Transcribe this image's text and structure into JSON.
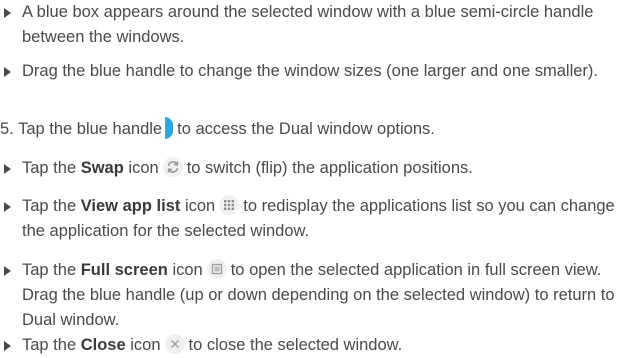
{
  "items": [
    {
      "type": "bullet",
      "text": "A blue box appears around the selected window with a blue semi-circle handle between the windows."
    },
    {
      "type": "bullet",
      "text": "Drag the blue handle to change the window sizes (one larger and one smaller)."
    },
    {
      "type": "step",
      "number": "5.",
      "before": "Tap the blue handle",
      "after": "to access the Dual window options.",
      "icon": "blue-handle-icon"
    },
    {
      "type": "bullet",
      "before": "Tap the",
      "bold": "Swap",
      "middle": "icon",
      "after": "to switch (flip) the application positions.",
      "icon": "swap-icon"
    },
    {
      "type": "bullet",
      "before": "Tap the",
      "bold": "View app list",
      "middle": "icon",
      "after": "to redisplay the applications list so you can change the application for the selected window.",
      "icon": "app-list-icon"
    },
    {
      "type": "bullet",
      "before": "Tap the",
      "bold": "Full screen",
      "middle": "icon",
      "after": "to open the selected application in full screen view. Drag the blue handle (up or down depending on the selected window) to return to Dual window.",
      "icon": "full-screen-icon"
    },
    {
      "type": "bullet",
      "before": "Tap the",
      "bold": "Close",
      "middle": "icon",
      "after": "to close the selected window.",
      "icon": "close-icon"
    }
  ],
  "colors": {
    "text": "#4a4a4a",
    "accent": "#29a7e6"
  }
}
